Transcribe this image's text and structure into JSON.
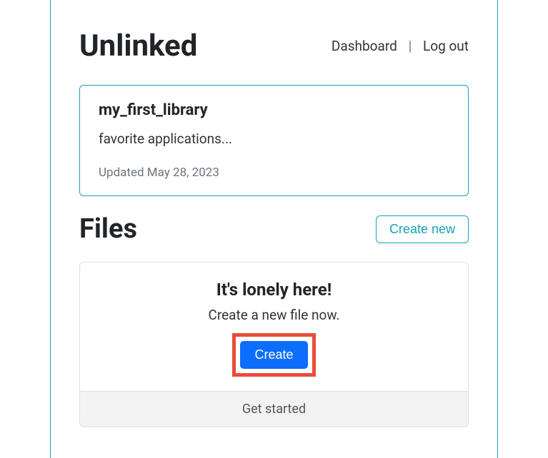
{
  "header": {
    "brand": "Unlinked",
    "nav": {
      "dashboard": "Dashboard",
      "logout": "Log out"
    }
  },
  "library": {
    "name": "my_first_library",
    "description": "favorite applications...",
    "updated": "Updated May 28, 2023"
  },
  "files": {
    "heading": "Files",
    "create_new": "Create new",
    "empty": {
      "title": "It's lonely here!",
      "subtitle": "Create a new file now.",
      "create": "Create",
      "footer": "Get started"
    }
  }
}
